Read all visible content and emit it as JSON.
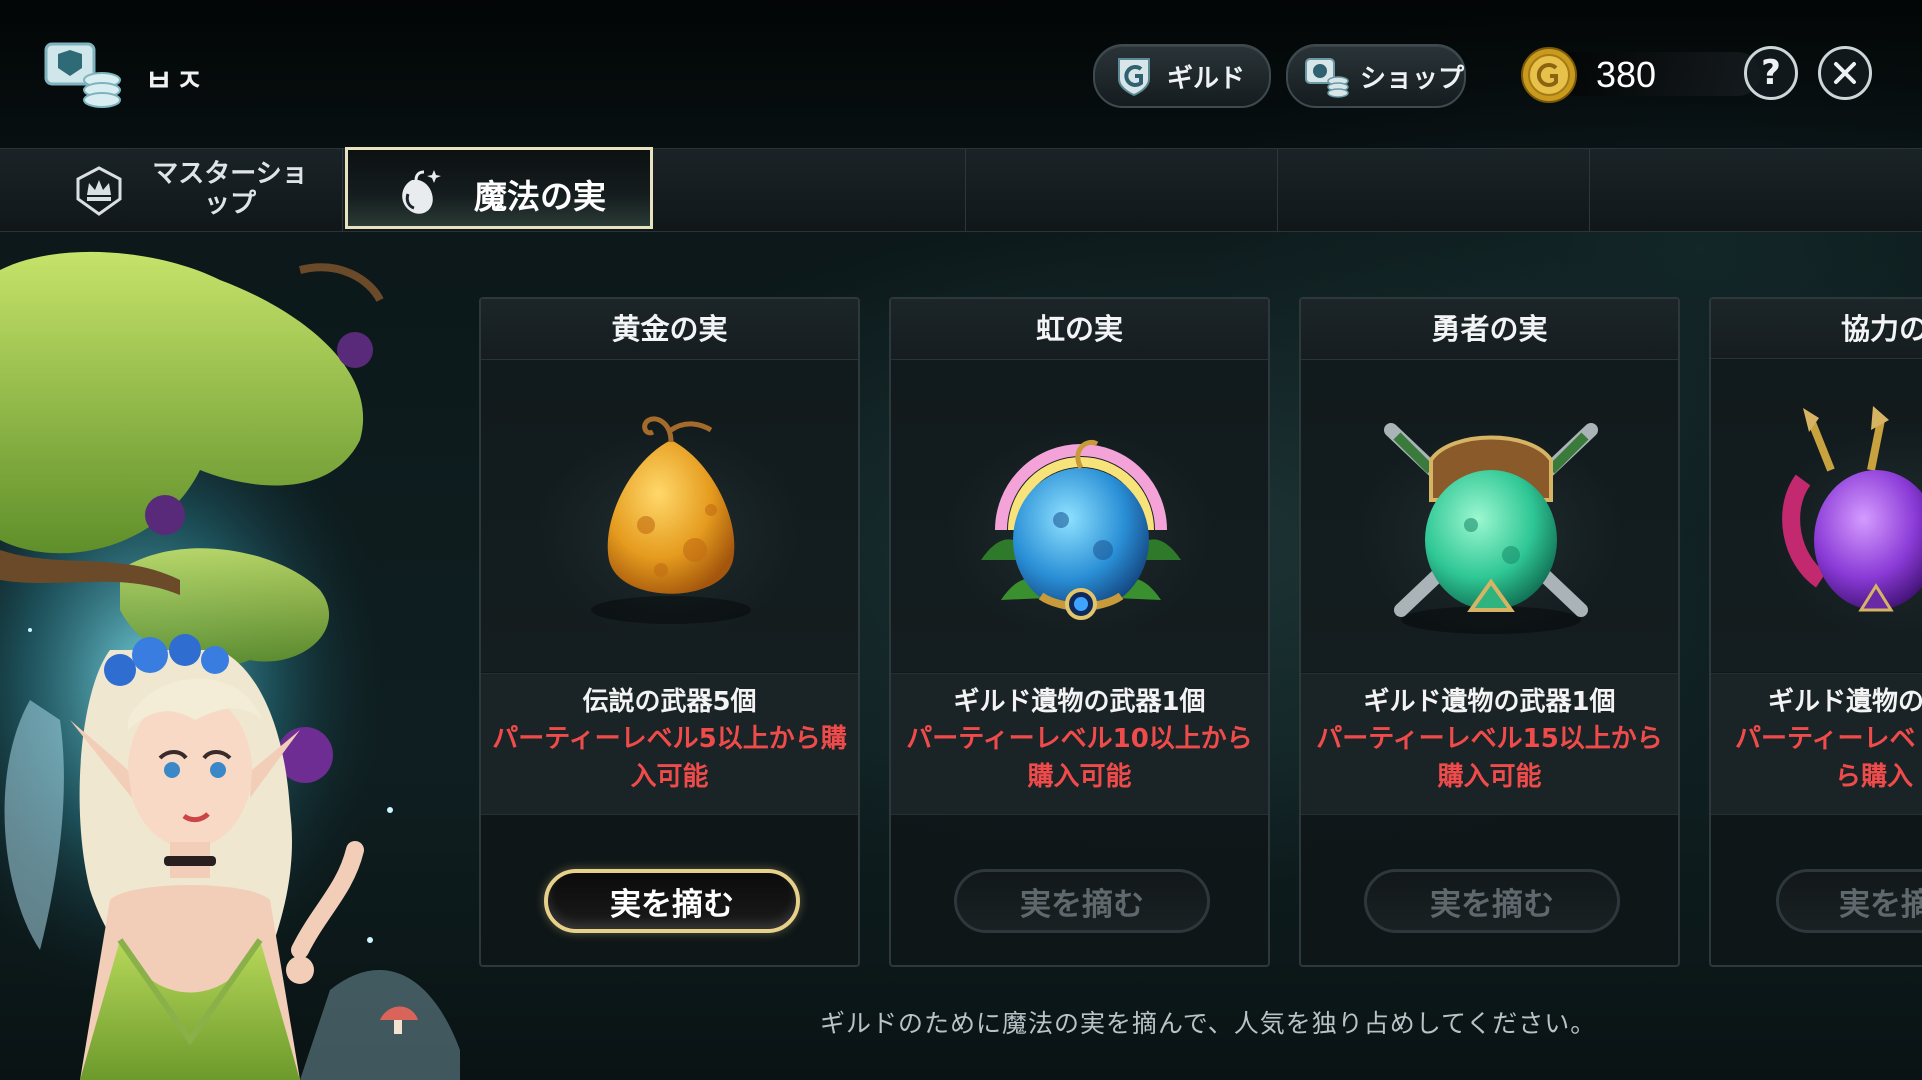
{
  "header": {
    "title": "ㅂㅈ",
    "logo_icon": "guild-coins-icon",
    "guild_button": {
      "label": "ギルド",
      "icon": "guild-shield-icon"
    },
    "shop_button": {
      "label": "ショップ",
      "icon": "shop-coins-icon"
    },
    "currency": {
      "icon": "gold-coin-icon",
      "amount": "380"
    },
    "help_button": {
      "label": "?",
      "icon": "help-icon"
    },
    "close_button": {
      "icon": "close-icon"
    }
  },
  "tabs": [
    {
      "label": "マスターショップ",
      "label_line1": "マスターショ",
      "label_line2": "ップ",
      "icon": "crown-shield-icon",
      "selected": false
    },
    {
      "label": "魔法の実",
      "icon": "magic-fruit-icon",
      "selected": true
    }
  ],
  "cards": [
    {
      "title": "黄金の実",
      "art": "golden-fruit-icon",
      "reward": "伝説の武器5個",
      "condition": "パーティーレベル5以上から購入可能",
      "button_label": "実を摘む",
      "enabled": true
    },
    {
      "title": "虹の実",
      "art": "rainbow-fruit-icon",
      "reward": "ギルド遺物の武器1個",
      "condition": "パーティーレベル10以上から購入可能",
      "button_label": "実を摘む",
      "enabled": false
    },
    {
      "title": "勇者の実",
      "art": "hero-fruit-icon",
      "reward": "ギルド遺物の武器1個",
      "condition": "パーティーレベル15以上から購入可能",
      "button_label": "実を摘む",
      "enabled": false
    },
    {
      "title": "協力の",
      "art": "cooperation-fruit-icon",
      "reward": "ギルド遺物の",
      "condition": "パーティーレベ ら購入",
      "condition_line1": "パーティーレベ",
      "condition_line2": "ら購入",
      "button_label": "実を摘",
      "enabled": false
    }
  ],
  "footer": {
    "message": "ギルドのために魔法の実を摘んで、人気を独り占めしてください。"
  },
  "colors": {
    "condition_text": "#ef4b4b",
    "active_button_border": "#e7d08a",
    "selected_tab_border": "#e9e2c0",
    "background": "#0b1416"
  }
}
